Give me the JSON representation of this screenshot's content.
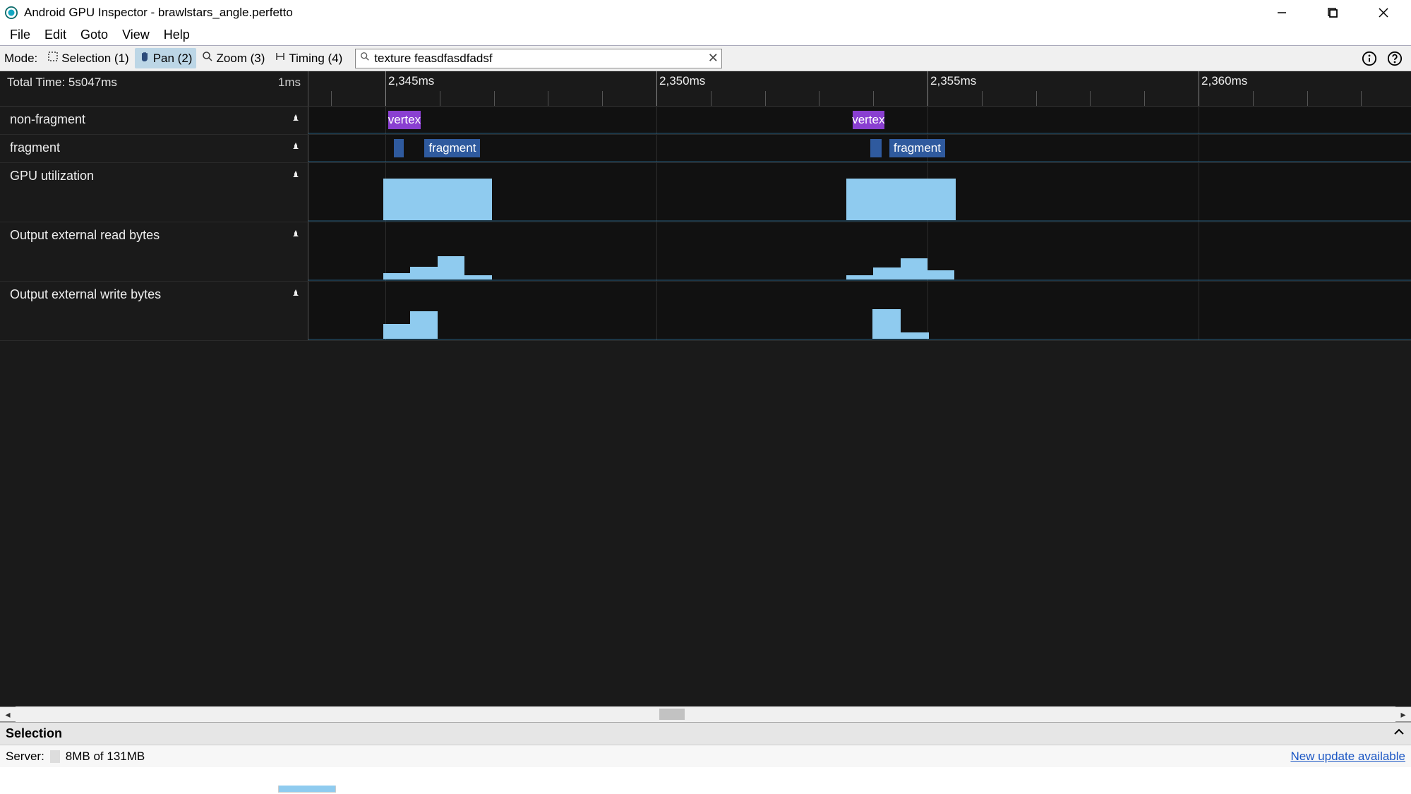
{
  "window": {
    "title": "Android GPU Inspector - brawlstars_angle.perfetto"
  },
  "menu": {
    "items": [
      "File",
      "Edit",
      "Goto",
      "View",
      "Help"
    ]
  },
  "toolbar": {
    "mode_label": "Mode:",
    "modes": {
      "selection": "Selection (1)",
      "pan": "Pan (2)",
      "zoom": "Zoom (3)",
      "timing": "Timing (4)"
    },
    "active_mode": "pan",
    "search_value": "texture feasdfasdfadsf"
  },
  "ruler": {
    "total_time_label": "Total Time: 5s047ms",
    "scale_label": "1ms",
    "major_ticks_ms": [
      2345,
      2350,
      2355,
      2360
    ],
    "visible_start_ms": 2343.58,
    "minor_step_ms": 1
  },
  "tracks": [
    {
      "id": "non-fragment",
      "label": "non-fragment",
      "height": "short"
    },
    {
      "id": "fragment",
      "label": "fragment",
      "height": "short"
    },
    {
      "id": "gpu-utilization",
      "label": "GPU utilization",
      "height": "tall"
    },
    {
      "id": "output-external-read-bytes",
      "label": "Output external read bytes",
      "height": "tall"
    },
    {
      "id": "output-external-write-bytes",
      "label": "Output external write bytes",
      "height": "tall"
    }
  ],
  "events": {
    "non_fragment": [
      {
        "label": "vertex",
        "start_ms": 2345.05,
        "end_ms": 2345.65,
        "cls": "vertex"
      },
      {
        "label": "vertex",
        "start_ms": 2353.62,
        "end_ms": 2354.2,
        "cls": "vertex"
      }
    ],
    "fragment": [
      {
        "label": "",
        "start_ms": 2345.15,
        "end_ms": 2345.34,
        "cls": "fragment"
      },
      {
        "label": "fragment",
        "start_ms": 2345.72,
        "end_ms": 2346.75,
        "cls": "fragment"
      },
      {
        "label": "",
        "start_ms": 2353.95,
        "end_ms": 2354.15,
        "cls": "fragment"
      },
      {
        "label": "fragment",
        "start_ms": 2354.3,
        "end_ms": 2355.32,
        "cls": "fragment"
      }
    ]
  },
  "histograms": {
    "gpu_utilization": [
      {
        "start_ms": 2344.96,
        "end_ms": 2346.97,
        "height_pct": 85
      },
      {
        "start_ms": 2353.5,
        "end_ms": 2355.52,
        "height_pct": 85
      }
    ],
    "output_external_read_bytes": [
      {
        "start_ms": 2344.96,
        "end_ms": 2345.46,
        "height_pct": 15
      },
      {
        "start_ms": 2345.46,
        "end_ms": 2345.96,
        "height_pct": 30
      },
      {
        "start_ms": 2345.96,
        "end_ms": 2346.46,
        "height_pct": 55
      },
      {
        "start_ms": 2346.46,
        "end_ms": 2346.96,
        "height_pct": 10
      },
      {
        "start_ms": 2353.5,
        "end_ms": 2354.0,
        "height_pct": 10
      },
      {
        "start_ms": 2354.0,
        "end_ms": 2354.5,
        "height_pct": 28
      },
      {
        "start_ms": 2354.5,
        "end_ms": 2355.0,
        "height_pct": 50
      },
      {
        "start_ms": 2355.0,
        "end_ms": 2355.5,
        "height_pct": 22
      }
    ],
    "output_external_write_bytes": [
      {
        "start_ms": 2344.96,
        "end_ms": 2345.46,
        "height_pct": 35
      },
      {
        "start_ms": 2345.46,
        "end_ms": 2345.96,
        "height_pct": 65
      },
      {
        "start_ms": 2353.98,
        "end_ms": 2354.5,
        "height_pct": 70
      },
      {
        "start_ms": 2354.5,
        "end_ms": 2355.02,
        "height_pct": 15
      }
    ]
  },
  "selection_panel": {
    "label": "Selection"
  },
  "status": {
    "server_label": "Server:",
    "memory": "8MB of 131MB",
    "update_link": "New update available"
  }
}
